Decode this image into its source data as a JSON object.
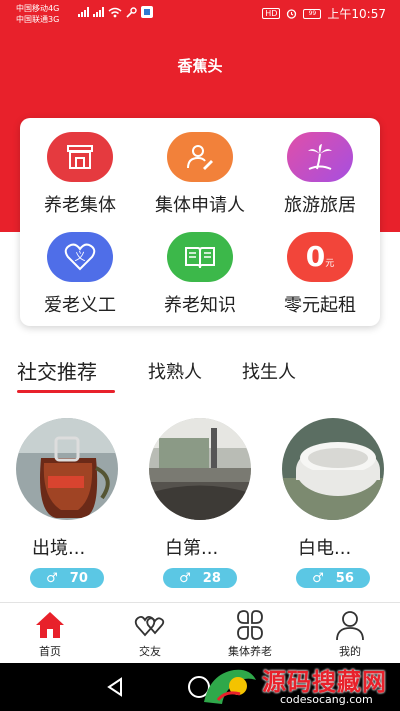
{
  "status_bar": {
    "carrier_1": "中国移动4G",
    "carrier_2": "中国联通3G",
    "hd": "HD",
    "battery": "99",
    "time": "上午10:57"
  },
  "header": {
    "title": "香蕉头"
  },
  "menu": {
    "items": [
      {
        "label": "养老集体",
        "icon": "store-icon",
        "color": "#e53a3f"
      },
      {
        "label": "集体申请人",
        "icon": "user-edit-icon",
        "color": "#f2813a"
      },
      {
        "label": "旅游旅居",
        "icon": "palm-tree-icon",
        "color": "#c94fd0"
      },
      {
        "label": "爱老义工",
        "icon": "heart-volunteer-icon",
        "color": "#4f6ee8",
        "icon_text": "义"
      },
      {
        "label": "养老知识",
        "icon": "book-icon",
        "color": "#3cb84a"
      },
      {
        "label": "零元起租",
        "icon": "zero-rent-icon",
        "color": "#f2453a",
        "icon_text": "0",
        "icon_subtext": "元"
      }
    ]
  },
  "tabs": [
    {
      "label": "社交推荐",
      "active": true
    },
    {
      "label": "找熟人",
      "active": false
    },
    {
      "label": "找生人",
      "active": false
    }
  ],
  "users": [
    {
      "name": "出境...",
      "gender_symbol": "♂",
      "age": "70"
    },
    {
      "name": "白第...",
      "gender_symbol": "♂",
      "age": "28"
    },
    {
      "name": "白电...",
      "gender_symbol": "♂",
      "age": "56"
    }
  ],
  "bottom_nav": [
    {
      "label": "首页",
      "icon": "home-icon",
      "active": true
    },
    {
      "label": "交友",
      "icon": "hearts-icon",
      "active": false
    },
    {
      "label": "集体养老",
      "icon": "grid-petals-icon",
      "active": false
    },
    {
      "label": "我的",
      "icon": "person-icon",
      "active": false
    }
  ],
  "watermark": {
    "text": "源码搜藏网",
    "url": "codesocang.com"
  },
  "colors": {
    "brand_red": "#e8212b",
    "badge_blue": "#5bc7e4"
  }
}
